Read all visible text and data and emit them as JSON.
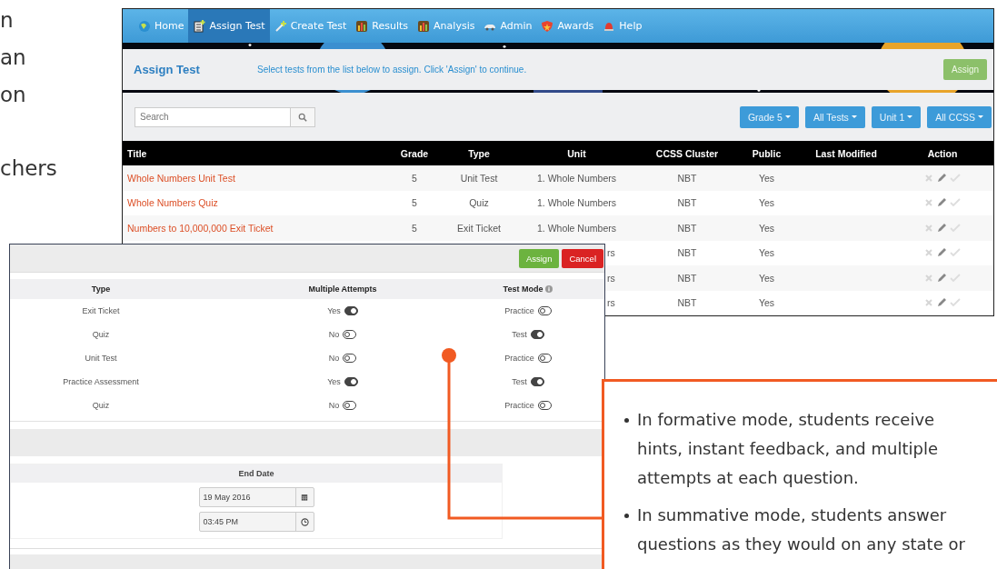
{
  "page_text": [
    {
      "lines": [
        "n",
        "an",
        "on"
      ]
    },
    {
      "lines": [
        "chers"
      ]
    }
  ],
  "nav": [
    {
      "label": "Home",
      "selected": false
    },
    {
      "label": "Assign Test",
      "selected": true
    },
    {
      "label": "Create Test",
      "selected": false
    },
    {
      "label": "Results",
      "selected": false
    },
    {
      "label": "Analysis",
      "selected": false
    },
    {
      "label": "Admin",
      "selected": false
    },
    {
      "label": "Awards",
      "selected": false
    },
    {
      "label": "Help",
      "selected": false
    }
  ],
  "header": {
    "title": "Assign Test",
    "hint": "Select tests from the list below to assign. Click 'Assign' to continue.",
    "button": "Assign"
  },
  "search": {
    "placeholder": "Search"
  },
  "filters": [
    "Grade 5",
    "All Tests",
    "Unit 1",
    "All CCSS"
  ],
  "table": {
    "columns": [
      "Title",
      "Grade",
      "Type",
      "Unit",
      "CCSS Cluster",
      "Public",
      "Last Modified",
      "Action"
    ],
    "rows": [
      {
        "covered": false,
        "title": "Whole Numbers Unit Test",
        "grade": "5",
        "type": "Unit Test",
        "unit": "1. Whole Numbers",
        "cluster": "NBT",
        "public": "Yes"
      },
      {
        "covered": false,
        "title": "Whole Numbers Quiz",
        "grade": "5",
        "type": "Quiz",
        "unit": "1. Whole Numbers",
        "cluster": "NBT",
        "public": "Yes"
      },
      {
        "covered": false,
        "title": "Numbers to 10,000,000 Exit Ticket",
        "grade": "5",
        "type": "Exit Ticket",
        "unit": "1. Whole Numbers",
        "cluster": "NBT",
        "public": "Yes"
      },
      {
        "covered": true,
        "unit": "rs",
        "cluster": "NBT",
        "public": "Yes"
      },
      {
        "covered": true,
        "unit": "rs",
        "cluster": "NBT",
        "public": "Yes"
      },
      {
        "covered": true,
        "unit": "rs",
        "cluster": "NBT",
        "public": "Yes"
      }
    ]
  },
  "modal": {
    "buttons": [
      {
        "label": "Assign",
        "kind": "primary"
      },
      {
        "label": "Cancel",
        "kind": "danger"
      }
    ],
    "columns": [
      "Type",
      "Multiple Attempts",
      "Test Mode"
    ],
    "rows": [
      {
        "type": "Exit Ticket",
        "attempts": "Yes",
        "attempts_on": true,
        "mode": "Practice",
        "mode_on": false
      },
      {
        "type": "Quiz",
        "attempts": "No",
        "attempts_on": false,
        "mode": "Test",
        "mode_on": true
      },
      {
        "type": "Unit Test",
        "attempts": "No",
        "attempts_on": false,
        "mode": "Practice",
        "mode_on": false
      },
      {
        "type": "Practice Assessment",
        "attempts": "Yes",
        "attempts_on": true,
        "mode": "Test",
        "mode_on": true
      },
      {
        "type": "Quiz",
        "attempts": "No",
        "attempts_on": false,
        "mode": "Practice",
        "mode_on": false
      }
    ],
    "end_date": {
      "heading": "End Date",
      "date": "19 May 2016",
      "time": "03:45 PM"
    }
  },
  "callout": [
    {
      "lines": [
        "In formative mode, students receive",
        "hints, instant feedback, and multiple",
        "attempts at each question."
      ]
    },
    {
      "lines": [
        "In summative mode, students answer",
        "questions as they would on any state or"
      ]
    }
  ]
}
